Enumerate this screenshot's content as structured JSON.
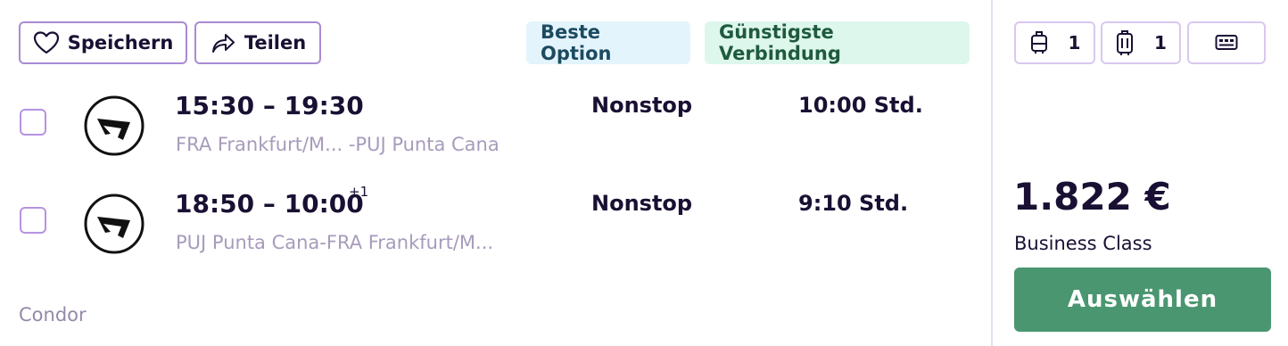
{
  "actions": {
    "save_label": "Speichern",
    "share_label": "Teilen"
  },
  "badges": {
    "best": "Beste Option",
    "cheapest": "Günstigste Verbindung"
  },
  "colors": {
    "accent_purple": "#a98bd4",
    "badge_blue_bg": "#e3f4fc",
    "badge_green_bg": "#ddf7ec",
    "cta_green": "#4a9670"
  },
  "flights": [
    {
      "time": "15:30 – 19:30",
      "day_offset": "",
      "route": "FRA Frankfurt/M... -PUJ Punta Cana",
      "stops": "Nonstop",
      "duration": "10:00 Std."
    },
    {
      "time": "18:50 – 10:00",
      "day_offset": "+1",
      "route": "PUJ Punta Cana-FRA Frankfurt/M...",
      "stops": "Nonstop",
      "duration": "9:10 Std."
    }
  ],
  "airline": "Condor",
  "luggage": {
    "cabin_count": "1",
    "checked_count": "1"
  },
  "price": {
    "amount": "1.822 €",
    "class": "Business Class",
    "select_label": "Auswählen"
  },
  "icons": [
    "heart-icon",
    "share-icon",
    "cabin-bag-icon",
    "suitcase-icon",
    "ticket-icon",
    "condor-logo-icon"
  ]
}
